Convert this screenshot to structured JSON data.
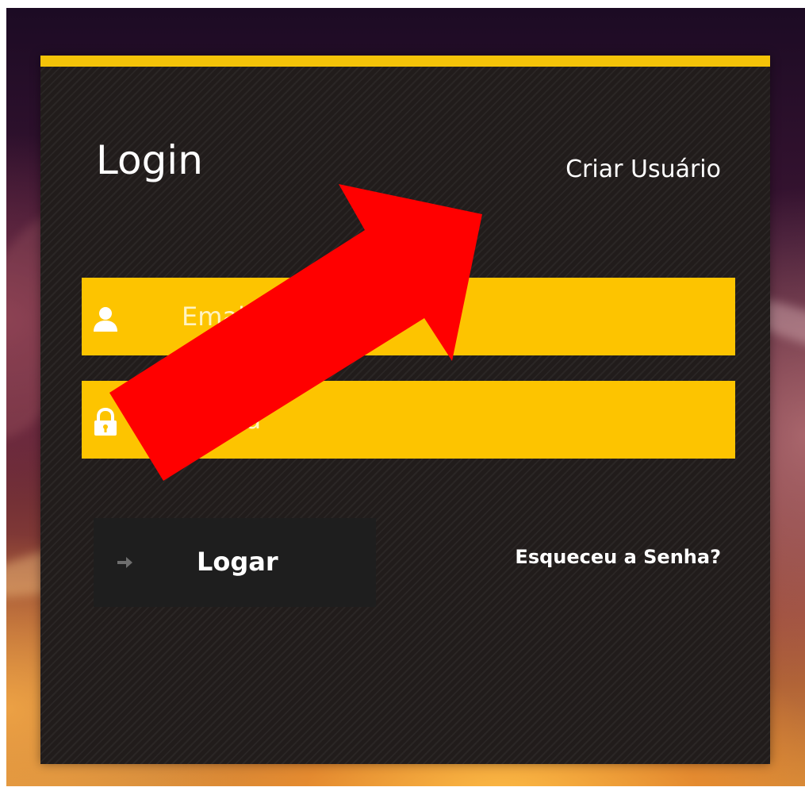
{
  "login": {
    "title": "Login",
    "create_user_label": "Criar Usuário",
    "email_placeholder": "Email",
    "password_placeholder": "Senha",
    "submit_label": "Logar",
    "forgot_password_label": "Esqueceu a Senha?"
  },
  "icons": {
    "email": "user-icon",
    "password": "lock-icon",
    "submit": "arrow-right-icon",
    "annotation": "red-arrow-annotation"
  },
  "colors": {
    "accent": "#fdc400",
    "top_bar": "#f4c308",
    "panel": "#211c1b",
    "button": "#1e1e1e",
    "annotation": "#ff0000"
  }
}
